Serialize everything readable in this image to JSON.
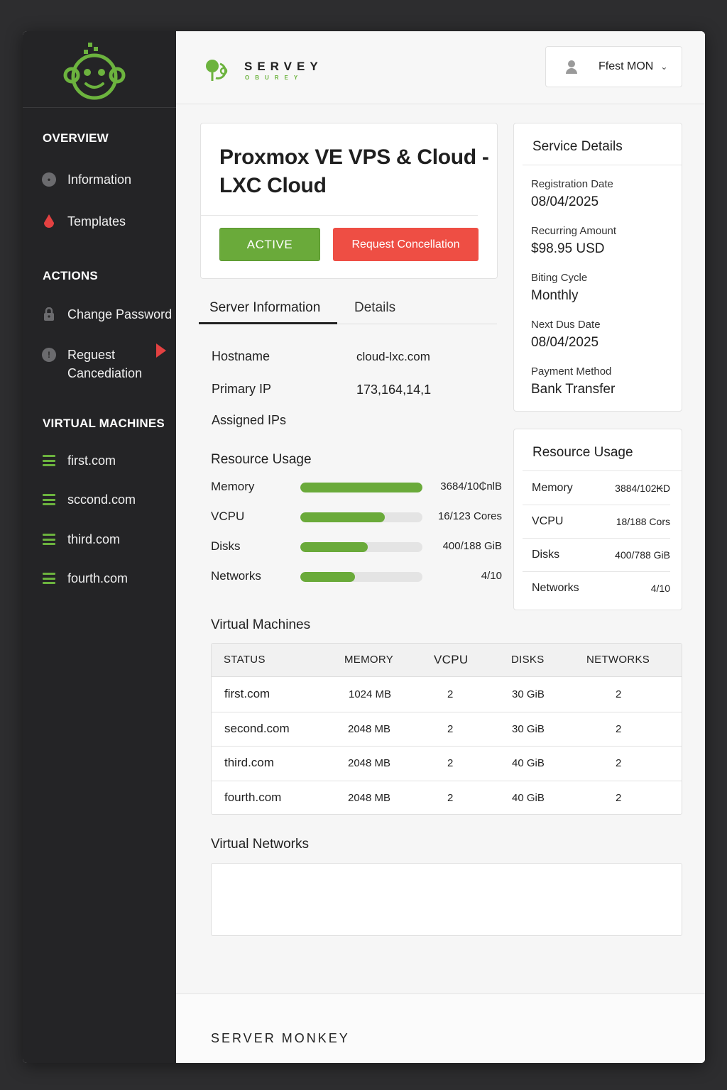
{
  "sidebar": {
    "overview_heading": "OVERVIEW",
    "overview_items": [
      {
        "label": "Information",
        "icon": "info-icon"
      },
      {
        "label": "Templates",
        "icon": "droplet-icon"
      }
    ],
    "actions_heading": "ACTIONS",
    "actions_items": [
      {
        "label": "Change Password",
        "icon": "lock-icon"
      },
      {
        "label": "Reguest Cancediation",
        "icon": "alert-icon"
      }
    ],
    "vm_heading": "VIRTUAL MACHINES",
    "vm_items": [
      "first.com",
      "sccond.com",
      "third.com",
      "fourth.com"
    ],
    "accent_color": "#6cb33e"
  },
  "header": {
    "brand_name": "SERVEY",
    "brand_sub": "OBUREY",
    "user_name": "Ffest MON"
  },
  "service": {
    "title": "Proxmox VE VPS & Cloud - LXC Cloud",
    "status_label": "ACTIVE",
    "cancel_label": "Request Concellation"
  },
  "tabs": [
    "Server Information",
    "Details"
  ],
  "server_info": [
    {
      "label": "Hostname",
      "value": "cloud-lxc.com"
    },
    {
      "label": "Primary IP",
      "value": "173,164,14,1"
    },
    {
      "label": "Assigned IPs",
      "value": ""
    }
  ],
  "resource_usage": {
    "title": "Resource Usage",
    "rows": [
      {
        "label": "Memory",
        "value": "3684/10₵nlB",
        "fraction": 1.0
      },
      {
        "label": "VCPU",
        "value": "16/123 Cores",
        "fraction": 0.69
      },
      {
        "label": "Disks",
        "value": "400/188 GiB",
        "fraction": 0.55
      },
      {
        "label": "Networks",
        "value": "4/10",
        "fraction": 0.45
      }
    ]
  },
  "service_details": {
    "title": "Service Details",
    "items": [
      {
        "label": "Registration Date",
        "value": "08/04/2025"
      },
      {
        "label": "Recurring Amount",
        "value": "$98.95 USD"
      },
      {
        "label": "Biting Cycle",
        "value": "Monthly"
      },
      {
        "label": "Next Dus Date",
        "value": "08/04/2025"
      },
      {
        "label": "Payment Method",
        "value": "Bank Transfer"
      }
    ]
  },
  "resource_card": {
    "title": "Resource Usage",
    "rows": [
      {
        "label": "Memory",
        "value": "3884/102₭D"
      },
      {
        "label": "VCPU",
        "value": "18/188 Cors"
      },
      {
        "label": "Disks",
        "value": "400/788 GiB"
      },
      {
        "label": "Networks",
        "value": "4/10"
      }
    ]
  },
  "virtual_machines": {
    "title": "Virtual Machines",
    "columns": [
      "STATUS",
      "MEMORY",
      "VCPU",
      "DISKS",
      "NETWORKS"
    ],
    "rows": [
      {
        "name": "first.com",
        "memory": "1024 MB",
        "vcpu": "2",
        "disks": "30 GiB",
        "networks": "2"
      },
      {
        "name": "second.com",
        "memory": "2048 MB",
        "vcpu": "2",
        "disks": "30 GiB",
        "networks": "2"
      },
      {
        "name": "third.com",
        "memory": "2048 MB",
        "vcpu": "2",
        "disks": "40 GiB",
        "networks": "2"
      },
      {
        "name": "fourth.com",
        "memory": "2048 MB",
        "vcpu": "2",
        "disks": "40 GiB",
        "networks": "2"
      }
    ]
  },
  "virtual_networks": {
    "title": "Virtual Networks"
  },
  "footer": {
    "text": "SERVER MONKEY"
  }
}
